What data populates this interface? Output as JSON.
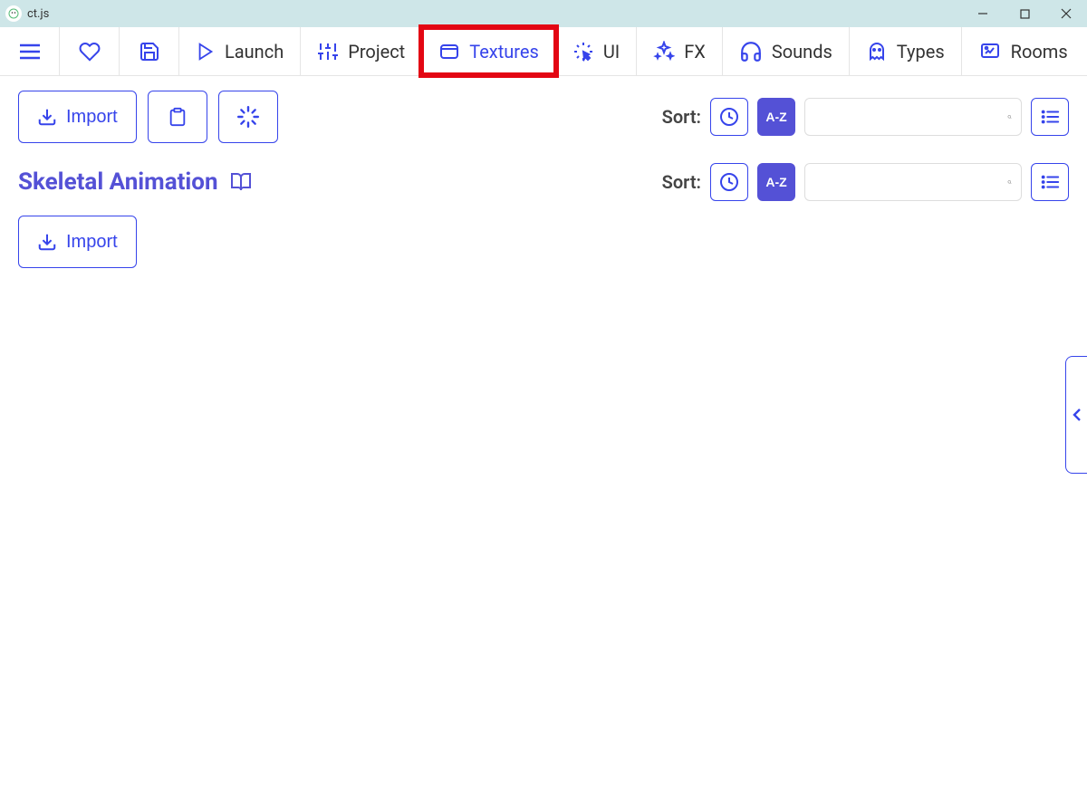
{
  "window": {
    "title": "ct.js"
  },
  "toolbar": {
    "launch": "Launch",
    "project": "Project",
    "textures": "Textures",
    "ui": "UI",
    "fx": "FX",
    "sounds": "Sounds",
    "types": "Types",
    "rooms": "Rooms"
  },
  "section1": {
    "import": "Import",
    "sort_label": "Sort:"
  },
  "section2": {
    "heading": "Skeletal Animation",
    "import": "Import",
    "sort_label": "Sort:"
  },
  "sort": {
    "az_text": "A-Z"
  }
}
